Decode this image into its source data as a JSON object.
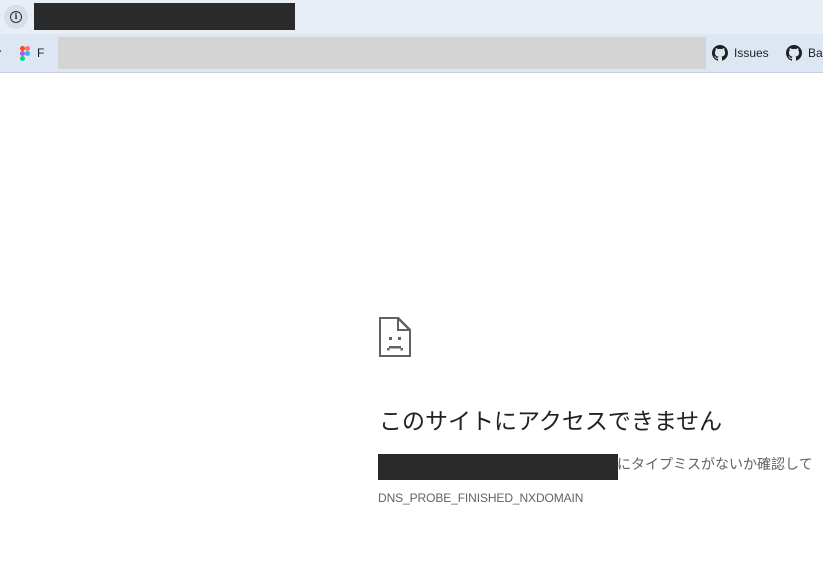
{
  "browser": {
    "site_info_icon": "info-icon",
    "url_redacted": true
  },
  "bookmarks": {
    "items": [
      {
        "label": "F",
        "icon": "figma-icon"
      },
      {
        "label": "Issues",
        "icon": "github-icon"
      },
      {
        "label": "Ba",
        "icon": "github-icon"
      }
    ]
  },
  "error_page": {
    "icon": "sad-page-icon",
    "heading": "このサイトにアクセスできません",
    "description_suffix": "にタイプミスがないか確認して",
    "error_code": "DNS_PROBE_FINISHED_NXDOMAIN"
  },
  "colors": {
    "heading": "#202124",
    "secondary_text": "#5f6368",
    "toolbar_bg": "#e8eef5",
    "bookmarks_bg": "#dde7f3"
  }
}
